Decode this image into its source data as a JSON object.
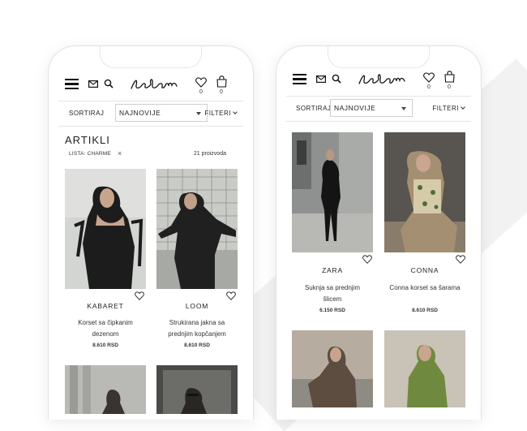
{
  "colors": {
    "background": "#ffffff",
    "text": "#222222",
    "border": "#e4e4e4"
  },
  "icons": [
    "menu-icon",
    "mail-icon",
    "search-icon",
    "heart-icon",
    "bag-icon",
    "chevron-down-icon",
    "close-icon"
  ],
  "phone_left": {
    "header": {
      "wishlist_count": "0",
      "cart_count": "0"
    },
    "sortbar": {
      "label": "SORTIRAJ",
      "selected": "NAJNOVIJE",
      "filter_label": "FILTERI"
    },
    "section_title": "ARTIKLI",
    "filter_chip": "LISTA: CHARME",
    "result_count": "21 proizvoda",
    "products": [
      {
        "brand": "KABARET",
        "name_lines": [
          "Korset sa čipkanim",
          "dezenom"
        ],
        "price": "8.610 RSD"
      },
      {
        "brand": "LOOM",
        "name_lines": [
          "Strukirana jakna sa",
          "prednjim kopčanjem"
        ],
        "price": "8.610 RSD"
      }
    ]
  },
  "phone_right": {
    "header": {
      "wishlist_count": "0",
      "cart_count": "0"
    },
    "sortbar": {
      "label": "SORTIRAJ",
      "selected": "NAJNOVIJE",
      "filter_label": "FILTERI"
    },
    "products": [
      {
        "brand": "ZARA",
        "name_lines": [
          "Suknja sa prednjim",
          "šlicem"
        ],
        "price": "6.150 RSD"
      },
      {
        "brand": "CONNA",
        "name_lines": [
          "Conna korset sa šarama"
        ],
        "price": "8.610 RSD"
      }
    ]
  }
}
